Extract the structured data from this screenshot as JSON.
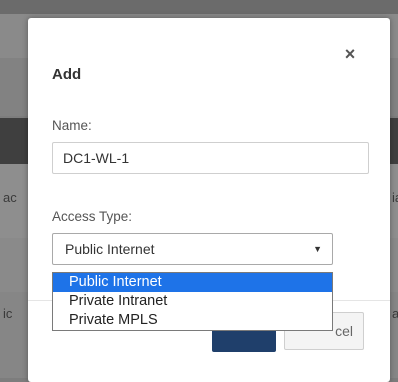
{
  "background": {
    "left_fragments": [
      "ac",
      "ic"
    ],
    "right_fragments": [
      "ia",
      "ai"
    ]
  },
  "dialog": {
    "title": "Add",
    "close_icon": "×",
    "name_label": "Name:",
    "name_value": "DC1-WL-1",
    "access_type_label": "Access Type:",
    "access_type_selected": "Public Internet",
    "dropdown_arrow": "▼",
    "options": [
      "Public Internet",
      "Private Intranet",
      "Private MPLS"
    ],
    "cancel_label_visible": "cel"
  },
  "colors": {
    "overlay": "#7d7d7d",
    "primary_button": "#1f3f6b",
    "highlight": "#1e73e8"
  }
}
